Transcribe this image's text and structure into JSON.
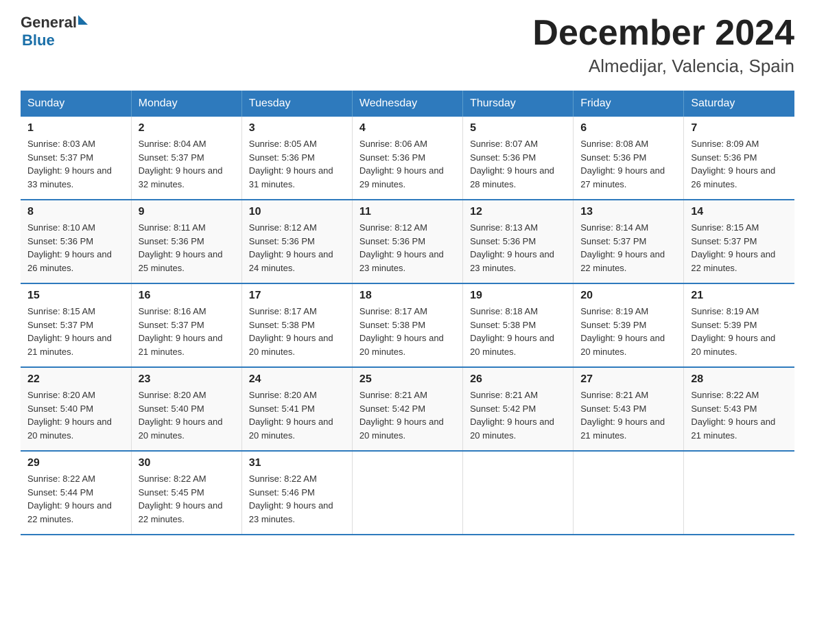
{
  "header": {
    "logo_general": "General",
    "logo_blue": "Blue",
    "month_title": "December 2024",
    "location": "Almedijar, Valencia, Spain"
  },
  "days_of_week": [
    "Sunday",
    "Monday",
    "Tuesday",
    "Wednesday",
    "Thursday",
    "Friday",
    "Saturday"
  ],
  "weeks": [
    [
      {
        "day": "1",
        "sunrise": "8:03 AM",
        "sunset": "5:37 PM",
        "daylight": "9 hours and 33 minutes."
      },
      {
        "day": "2",
        "sunrise": "8:04 AM",
        "sunset": "5:37 PM",
        "daylight": "9 hours and 32 minutes."
      },
      {
        "day": "3",
        "sunrise": "8:05 AM",
        "sunset": "5:36 PM",
        "daylight": "9 hours and 31 minutes."
      },
      {
        "day": "4",
        "sunrise": "8:06 AM",
        "sunset": "5:36 PM",
        "daylight": "9 hours and 29 minutes."
      },
      {
        "day": "5",
        "sunrise": "8:07 AM",
        "sunset": "5:36 PM",
        "daylight": "9 hours and 28 minutes."
      },
      {
        "day": "6",
        "sunrise": "8:08 AM",
        "sunset": "5:36 PM",
        "daylight": "9 hours and 27 minutes."
      },
      {
        "day": "7",
        "sunrise": "8:09 AM",
        "sunset": "5:36 PM",
        "daylight": "9 hours and 26 minutes."
      }
    ],
    [
      {
        "day": "8",
        "sunrise": "8:10 AM",
        "sunset": "5:36 PM",
        "daylight": "9 hours and 26 minutes."
      },
      {
        "day": "9",
        "sunrise": "8:11 AM",
        "sunset": "5:36 PM",
        "daylight": "9 hours and 25 minutes."
      },
      {
        "day": "10",
        "sunrise": "8:12 AM",
        "sunset": "5:36 PM",
        "daylight": "9 hours and 24 minutes."
      },
      {
        "day": "11",
        "sunrise": "8:12 AM",
        "sunset": "5:36 PM",
        "daylight": "9 hours and 23 minutes."
      },
      {
        "day": "12",
        "sunrise": "8:13 AM",
        "sunset": "5:36 PM",
        "daylight": "9 hours and 23 minutes."
      },
      {
        "day": "13",
        "sunrise": "8:14 AM",
        "sunset": "5:37 PM",
        "daylight": "9 hours and 22 minutes."
      },
      {
        "day": "14",
        "sunrise": "8:15 AM",
        "sunset": "5:37 PM",
        "daylight": "9 hours and 22 minutes."
      }
    ],
    [
      {
        "day": "15",
        "sunrise": "8:15 AM",
        "sunset": "5:37 PM",
        "daylight": "9 hours and 21 minutes."
      },
      {
        "day": "16",
        "sunrise": "8:16 AM",
        "sunset": "5:37 PM",
        "daylight": "9 hours and 21 minutes."
      },
      {
        "day": "17",
        "sunrise": "8:17 AM",
        "sunset": "5:38 PM",
        "daylight": "9 hours and 20 minutes."
      },
      {
        "day": "18",
        "sunrise": "8:17 AM",
        "sunset": "5:38 PM",
        "daylight": "9 hours and 20 minutes."
      },
      {
        "day": "19",
        "sunrise": "8:18 AM",
        "sunset": "5:38 PM",
        "daylight": "9 hours and 20 minutes."
      },
      {
        "day": "20",
        "sunrise": "8:19 AM",
        "sunset": "5:39 PM",
        "daylight": "9 hours and 20 minutes."
      },
      {
        "day": "21",
        "sunrise": "8:19 AM",
        "sunset": "5:39 PM",
        "daylight": "9 hours and 20 minutes."
      }
    ],
    [
      {
        "day": "22",
        "sunrise": "8:20 AM",
        "sunset": "5:40 PM",
        "daylight": "9 hours and 20 minutes."
      },
      {
        "day": "23",
        "sunrise": "8:20 AM",
        "sunset": "5:40 PM",
        "daylight": "9 hours and 20 minutes."
      },
      {
        "day": "24",
        "sunrise": "8:20 AM",
        "sunset": "5:41 PM",
        "daylight": "9 hours and 20 minutes."
      },
      {
        "day": "25",
        "sunrise": "8:21 AM",
        "sunset": "5:42 PM",
        "daylight": "9 hours and 20 minutes."
      },
      {
        "day": "26",
        "sunrise": "8:21 AM",
        "sunset": "5:42 PM",
        "daylight": "9 hours and 20 minutes."
      },
      {
        "day": "27",
        "sunrise": "8:21 AM",
        "sunset": "5:43 PM",
        "daylight": "9 hours and 21 minutes."
      },
      {
        "day": "28",
        "sunrise": "8:22 AM",
        "sunset": "5:43 PM",
        "daylight": "9 hours and 21 minutes."
      }
    ],
    [
      {
        "day": "29",
        "sunrise": "8:22 AM",
        "sunset": "5:44 PM",
        "daylight": "9 hours and 22 minutes."
      },
      {
        "day": "30",
        "sunrise": "8:22 AM",
        "sunset": "5:45 PM",
        "daylight": "9 hours and 22 minutes."
      },
      {
        "day": "31",
        "sunrise": "8:22 AM",
        "sunset": "5:46 PM",
        "daylight": "9 hours and 23 minutes."
      },
      null,
      null,
      null,
      null
    ]
  ]
}
